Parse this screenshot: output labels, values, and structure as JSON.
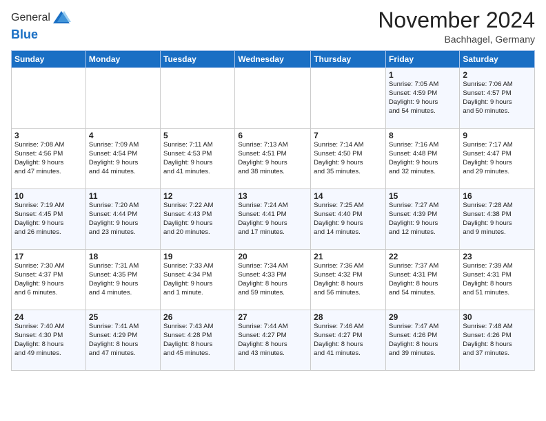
{
  "header": {
    "logo_line1": "General",
    "logo_line2": "Blue",
    "month": "November 2024",
    "location": "Bachhagel, Germany"
  },
  "days_of_week": [
    "Sunday",
    "Monday",
    "Tuesday",
    "Wednesday",
    "Thursday",
    "Friday",
    "Saturday"
  ],
  "weeks": [
    [
      {
        "day": "",
        "info": ""
      },
      {
        "day": "",
        "info": ""
      },
      {
        "day": "",
        "info": ""
      },
      {
        "day": "",
        "info": ""
      },
      {
        "day": "",
        "info": ""
      },
      {
        "day": "1",
        "info": "Sunrise: 7:05 AM\nSunset: 4:59 PM\nDaylight: 9 hours\nand 54 minutes."
      },
      {
        "day": "2",
        "info": "Sunrise: 7:06 AM\nSunset: 4:57 PM\nDaylight: 9 hours\nand 50 minutes."
      }
    ],
    [
      {
        "day": "3",
        "info": "Sunrise: 7:08 AM\nSunset: 4:56 PM\nDaylight: 9 hours\nand 47 minutes."
      },
      {
        "day": "4",
        "info": "Sunrise: 7:09 AM\nSunset: 4:54 PM\nDaylight: 9 hours\nand 44 minutes."
      },
      {
        "day": "5",
        "info": "Sunrise: 7:11 AM\nSunset: 4:53 PM\nDaylight: 9 hours\nand 41 minutes."
      },
      {
        "day": "6",
        "info": "Sunrise: 7:13 AM\nSunset: 4:51 PM\nDaylight: 9 hours\nand 38 minutes."
      },
      {
        "day": "7",
        "info": "Sunrise: 7:14 AM\nSunset: 4:50 PM\nDaylight: 9 hours\nand 35 minutes."
      },
      {
        "day": "8",
        "info": "Sunrise: 7:16 AM\nSunset: 4:48 PM\nDaylight: 9 hours\nand 32 minutes."
      },
      {
        "day": "9",
        "info": "Sunrise: 7:17 AM\nSunset: 4:47 PM\nDaylight: 9 hours\nand 29 minutes."
      }
    ],
    [
      {
        "day": "10",
        "info": "Sunrise: 7:19 AM\nSunset: 4:45 PM\nDaylight: 9 hours\nand 26 minutes."
      },
      {
        "day": "11",
        "info": "Sunrise: 7:20 AM\nSunset: 4:44 PM\nDaylight: 9 hours\nand 23 minutes."
      },
      {
        "day": "12",
        "info": "Sunrise: 7:22 AM\nSunset: 4:43 PM\nDaylight: 9 hours\nand 20 minutes."
      },
      {
        "day": "13",
        "info": "Sunrise: 7:24 AM\nSunset: 4:41 PM\nDaylight: 9 hours\nand 17 minutes."
      },
      {
        "day": "14",
        "info": "Sunrise: 7:25 AM\nSunset: 4:40 PM\nDaylight: 9 hours\nand 14 minutes."
      },
      {
        "day": "15",
        "info": "Sunrise: 7:27 AM\nSunset: 4:39 PM\nDaylight: 9 hours\nand 12 minutes."
      },
      {
        "day": "16",
        "info": "Sunrise: 7:28 AM\nSunset: 4:38 PM\nDaylight: 9 hours\nand 9 minutes."
      }
    ],
    [
      {
        "day": "17",
        "info": "Sunrise: 7:30 AM\nSunset: 4:37 PM\nDaylight: 9 hours\nand 6 minutes."
      },
      {
        "day": "18",
        "info": "Sunrise: 7:31 AM\nSunset: 4:35 PM\nDaylight: 9 hours\nand 4 minutes."
      },
      {
        "day": "19",
        "info": "Sunrise: 7:33 AM\nSunset: 4:34 PM\nDaylight: 9 hours\nand 1 minute."
      },
      {
        "day": "20",
        "info": "Sunrise: 7:34 AM\nSunset: 4:33 PM\nDaylight: 8 hours\nand 59 minutes."
      },
      {
        "day": "21",
        "info": "Sunrise: 7:36 AM\nSunset: 4:32 PM\nDaylight: 8 hours\nand 56 minutes."
      },
      {
        "day": "22",
        "info": "Sunrise: 7:37 AM\nSunset: 4:31 PM\nDaylight: 8 hours\nand 54 minutes."
      },
      {
        "day": "23",
        "info": "Sunrise: 7:39 AM\nSunset: 4:31 PM\nDaylight: 8 hours\nand 51 minutes."
      }
    ],
    [
      {
        "day": "24",
        "info": "Sunrise: 7:40 AM\nSunset: 4:30 PM\nDaylight: 8 hours\nand 49 minutes."
      },
      {
        "day": "25",
        "info": "Sunrise: 7:41 AM\nSunset: 4:29 PM\nDaylight: 8 hours\nand 47 minutes."
      },
      {
        "day": "26",
        "info": "Sunrise: 7:43 AM\nSunset: 4:28 PM\nDaylight: 8 hours\nand 45 minutes."
      },
      {
        "day": "27",
        "info": "Sunrise: 7:44 AM\nSunset: 4:27 PM\nDaylight: 8 hours\nand 43 minutes."
      },
      {
        "day": "28",
        "info": "Sunrise: 7:46 AM\nSunset: 4:27 PM\nDaylight: 8 hours\nand 41 minutes."
      },
      {
        "day": "29",
        "info": "Sunrise: 7:47 AM\nSunset: 4:26 PM\nDaylight: 8 hours\nand 39 minutes."
      },
      {
        "day": "30",
        "info": "Sunrise: 7:48 AM\nSunset: 4:26 PM\nDaylight: 8 hours\nand 37 minutes."
      }
    ]
  ]
}
